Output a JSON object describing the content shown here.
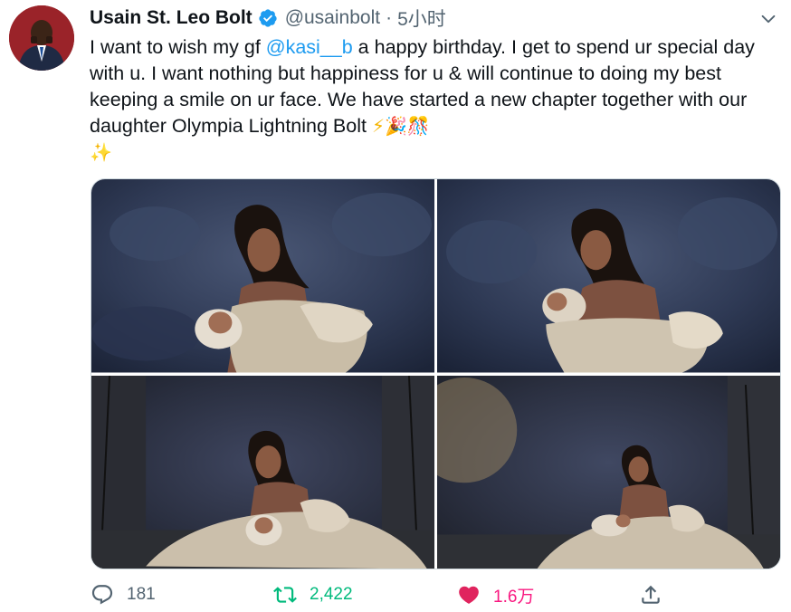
{
  "tweet": {
    "display_name": "Usain St. Leo Bolt",
    "handle": "@usainbolt",
    "separator": "·",
    "time": "5小时",
    "text_before": "I want to wish my gf ",
    "mention": "@kasi__b",
    "text_after": " a happy birthday. I get to spend ur special day with u. I want nothing but happiness for u & will continue to doing my best keeping a smile on ur face. We have started a new chapter together with our daughter Olympia Lightning Bolt ",
    "emojis": [
      "high-voltage",
      "party-popper",
      "confetti-ball",
      "dizzy-star"
    ]
  },
  "media": {
    "photos": [
      {
        "name": "photo-1",
        "description_icon": "mother-baby-photo"
      },
      {
        "name": "photo-2",
        "description_icon": "mother-baby-photo"
      },
      {
        "name": "photo-3",
        "description_icon": "mother-baby-photo"
      },
      {
        "name": "photo-4",
        "description_icon": "mother-baby-photo"
      }
    ]
  },
  "actions": {
    "reply_count": "181",
    "retweet_count": "2,422",
    "like_count": "1.6万",
    "icons": [
      "reply-icon",
      "retweet-icon",
      "heart-icon",
      "share-icon"
    ]
  },
  "colors": {
    "accent": "#1d9bf0",
    "retweet": "#00ba7c",
    "like": "#f91880",
    "muted": "#536471",
    "verified": "#1d9bf0"
  }
}
